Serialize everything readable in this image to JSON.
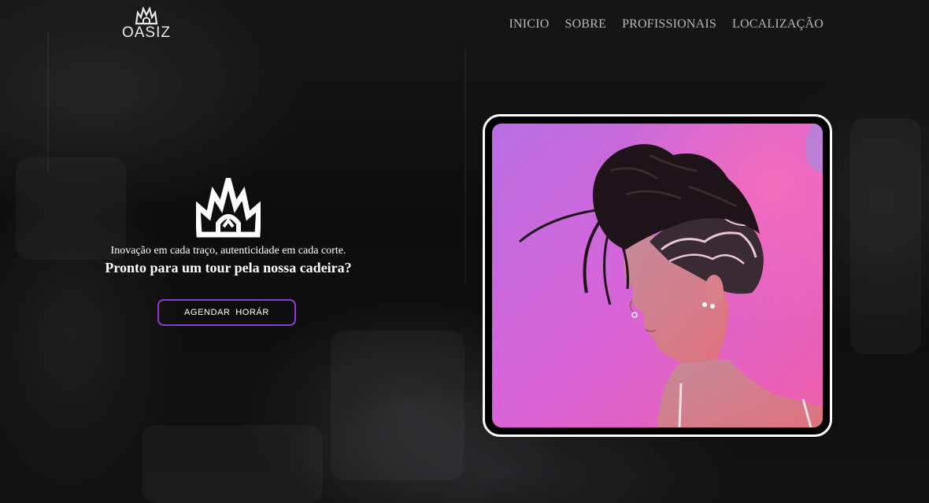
{
  "header": {
    "logo_text": "OASIZ",
    "nav": [
      {
        "label": "INICIO"
      },
      {
        "label": "SOBRE"
      },
      {
        "label": "PROFISSIONAIS"
      },
      {
        "label": "LOCALIZAÇÃO"
      }
    ]
  },
  "hero": {
    "tagline": "Inovação em cada traço, autenticidade em cada corte.",
    "cta_text": "Pronto para um tour pela nossa cadeira?",
    "button_label": "AGENDAR  HORÁR"
  },
  "icons": {
    "logo": "crown-logo-icon",
    "hero": "crown-emblem-icon"
  },
  "colors": {
    "background": "#0d0d0e",
    "accent": "#8a3cd6",
    "nav_text": "#b7b7b7",
    "photo_pink": "#e25fd6",
    "photo_violet": "#b776e6",
    "frame": "#ffffff"
  }
}
